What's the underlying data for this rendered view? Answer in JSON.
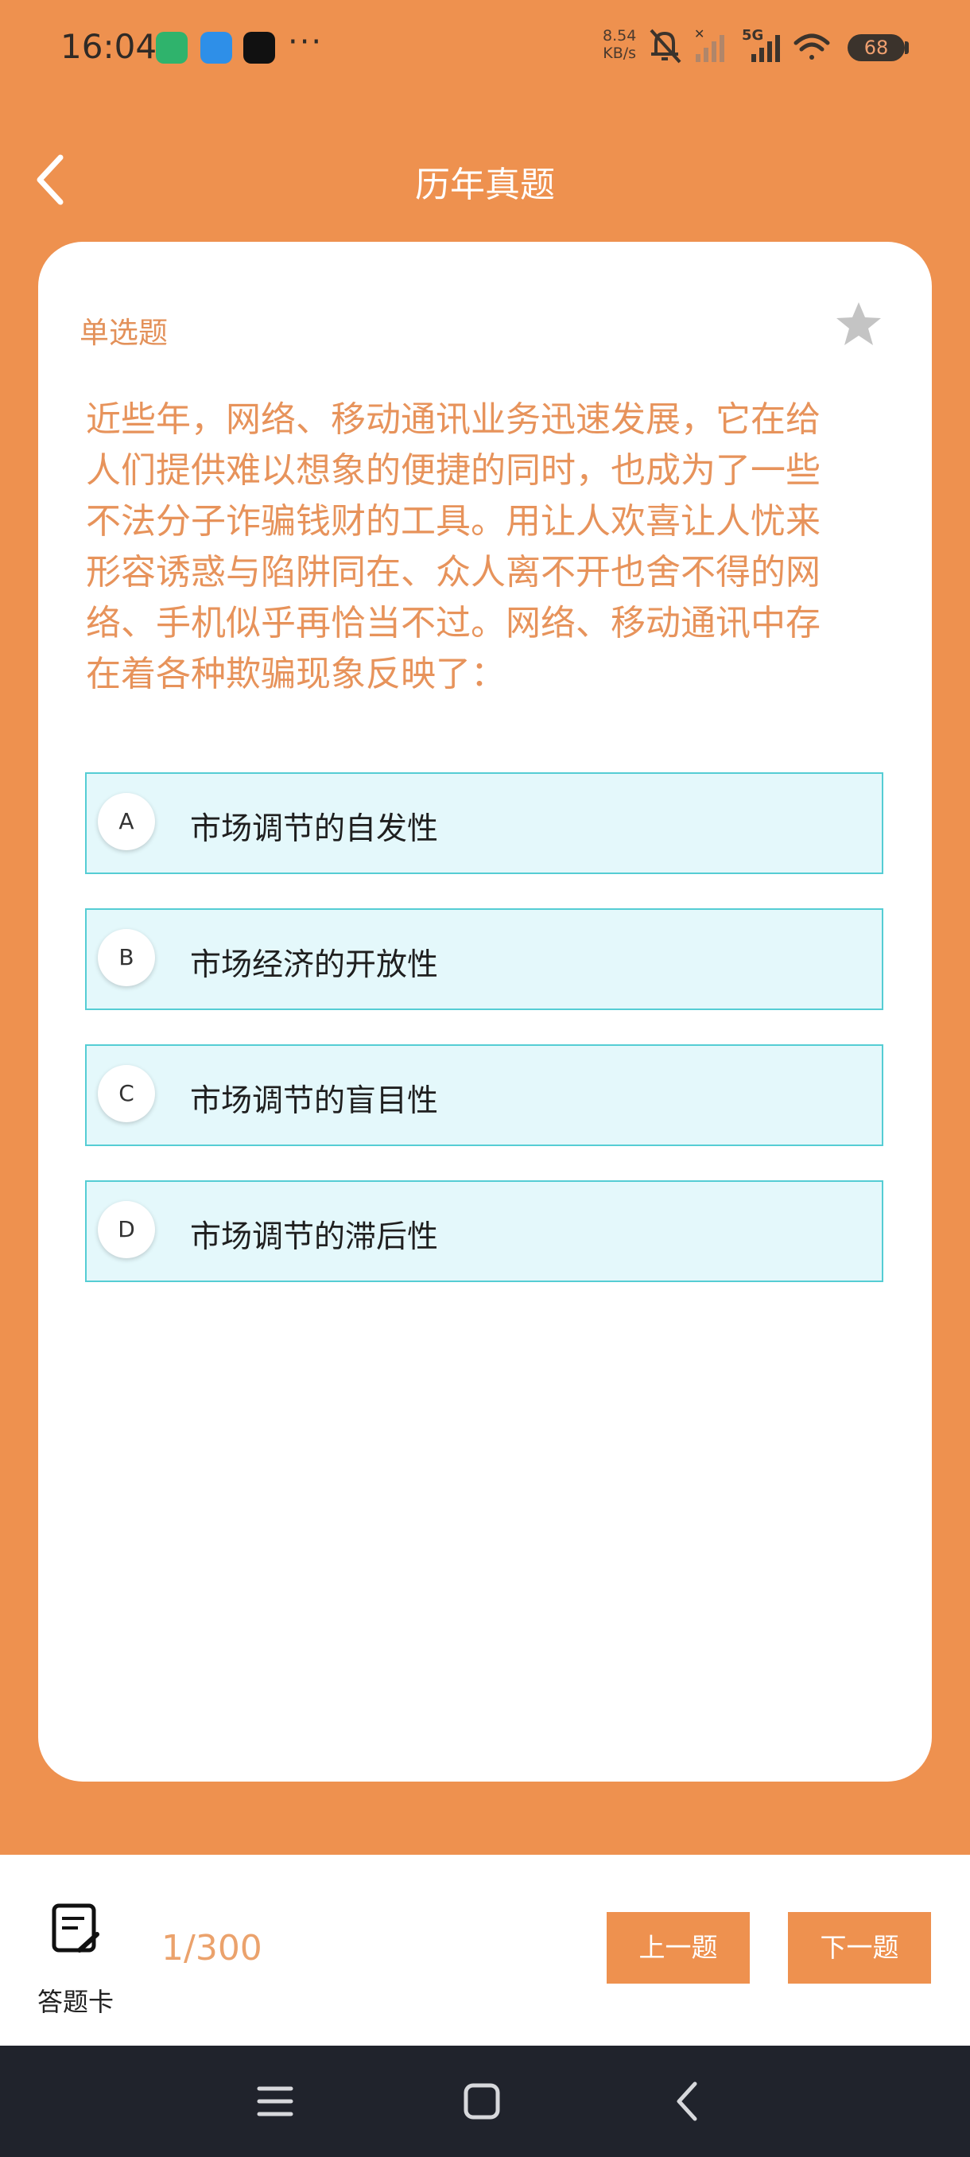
{
  "status_bar": {
    "time": "16:04",
    "more": "···",
    "net_speed_value": "8.54",
    "net_speed_unit": "KB/s",
    "network_label": "5G",
    "battery": "68",
    "icons": [
      "android-icon",
      "weather-icon",
      "tiktok-icon",
      "mute-icon",
      "signal-off-icon",
      "signal-5g-icon",
      "wifi-icon",
      "battery-icon"
    ]
  },
  "header": {
    "title": "历年真题",
    "back_icon": "chevron-left-icon"
  },
  "question": {
    "type": "单选题",
    "favorite_icon": "star-icon",
    "lines": [
      "近些年，网络、移动通讯业务迅速发展，它在给",
      "人们提供难以想象的便捷的同时，也成为了一些",
      "不法分子诈骗钱财的工具。用让人欢喜让人忧来",
      "形容诱惑与陷阱同在、众人离不开也舍不得的网",
      "络、手机似乎再恰当不过。网络、移动通讯中存",
      "在着各种欺骗现象反映了："
    ],
    "options": [
      {
        "letter": "A",
        "text": "市场调节的自发性"
      },
      {
        "letter": "B",
        "text": "市场经济的开放性"
      },
      {
        "letter": "C",
        "text": "市场调节的盲目性"
      },
      {
        "letter": "D",
        "text": "市场调节的滞后性"
      }
    ]
  },
  "bottom_bar": {
    "answer_card_label": "答题卡",
    "progress": "1/300",
    "prev_label": "上一题",
    "next_label": "下一题"
  },
  "colors": {
    "background": "#ee914f",
    "accent_text": "#e7935b",
    "option_bg": "#e4f8fb",
    "option_border": "#55cdd4",
    "nav_bar": "#20232c"
  }
}
